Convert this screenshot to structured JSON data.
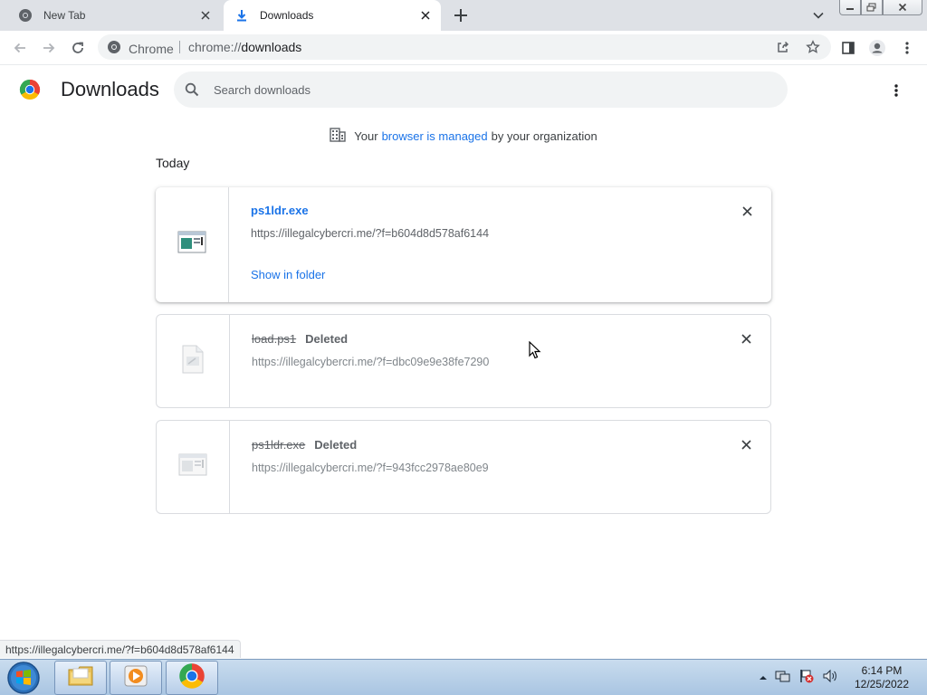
{
  "browser": {
    "tabs": [
      {
        "label": "New Tab",
        "active": false,
        "icon": "chrome-icon"
      },
      {
        "label": "Downloads",
        "active": true,
        "icon": "download-icon"
      }
    ],
    "omnibox": {
      "site_label": "Chrome",
      "url_scheme": "chrome://",
      "url_host": "downloads"
    }
  },
  "page": {
    "title": "Downloads",
    "search_placeholder": "Search downloads",
    "managed": {
      "prefix": "Your",
      "link": "browser is managed",
      "suffix": "by your organization"
    },
    "section_date": "Today",
    "downloads": [
      {
        "file_name": "ps1ldr.exe",
        "url": "https://illegalcybercri.me/?f=b604d8d578af6144",
        "action": "Show in folder",
        "status": "",
        "deleted": false
      },
      {
        "file_name": "load.ps1",
        "url": "https://illegalcybercri.me/?f=dbc09e9e38fe7290",
        "action": "",
        "status": "Deleted",
        "deleted": true
      },
      {
        "file_name": "ps1ldr.exe",
        "url": "https://illegalcybercri.me/?f=943fcc2978ae80e9",
        "action": "",
        "status": "Deleted",
        "deleted": true
      }
    ]
  },
  "status_bar": "https://illegalcybercri.me/?f=b604d8d578af6144",
  "taskbar": {
    "time": "6:14 PM",
    "date": "12/25/2022"
  },
  "colors": {
    "accent": "#1a73e8",
    "tabstrip": "#dee1e6",
    "search_bg": "#f1f3f4"
  }
}
